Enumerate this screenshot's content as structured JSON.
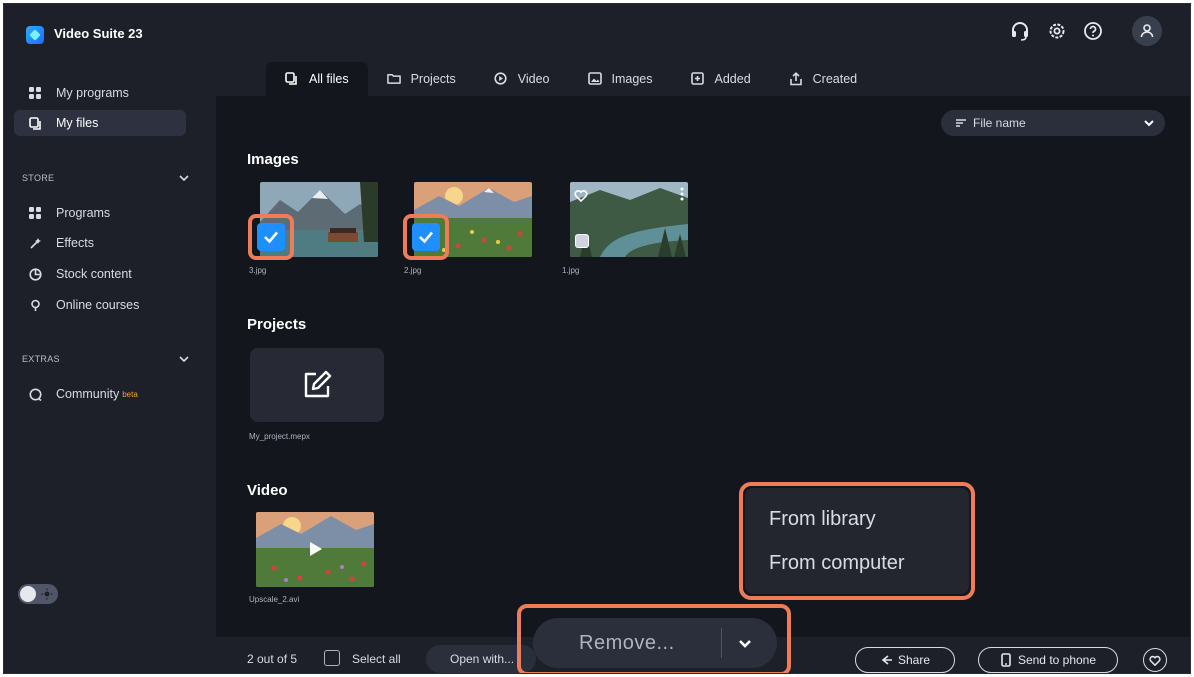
{
  "app": {
    "title": "Video Suite 23"
  },
  "header": {
    "icons": [
      "support-icon",
      "settings-icon",
      "help-icon",
      "user-icon"
    ]
  },
  "sidebar": {
    "my_programs": "My programs",
    "my_files": "My files",
    "store_label": "STORE",
    "store_items": [
      "Programs",
      "Effects",
      "Stock content",
      "Online courses"
    ],
    "extras_label": "EXTRAS",
    "community": "Community",
    "community_badge": "beta"
  },
  "tabs": [
    "All files",
    "Projects",
    "Video",
    "Images",
    "Added",
    "Created"
  ],
  "sort": {
    "label": "File name"
  },
  "sections": {
    "images": {
      "title": "Images",
      "items": [
        {
          "label": "3.jpg",
          "selected": true
        },
        {
          "label": "2.jpg",
          "selected": true
        },
        {
          "label": "1.jpg",
          "selected": false
        }
      ]
    },
    "projects": {
      "title": "Projects",
      "items": [
        {
          "label": "My_project.mepx"
        }
      ]
    },
    "video": {
      "title": "Video",
      "items": [
        {
          "label": "Upscale_2.avi"
        }
      ]
    }
  },
  "bottom": {
    "count": "2 out of 5",
    "select_all": "Select all",
    "open_with": "Open with...",
    "remove": "Remove...",
    "share": "Share",
    "send_to_phone": "Send to phone"
  },
  "menu": {
    "items": [
      "From library",
      "From computer"
    ]
  },
  "colors": {
    "accent": "#1f8fff",
    "highlight": "#ec7d58",
    "background": "#1d2029",
    "panel": "#14161d"
  }
}
